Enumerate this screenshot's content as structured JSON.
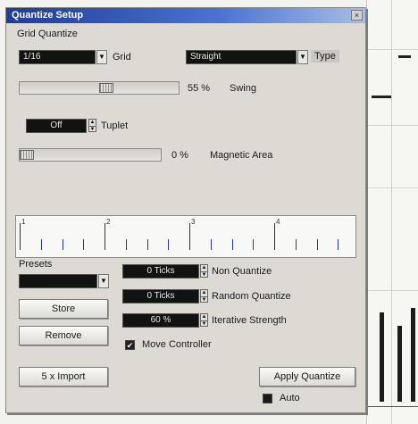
{
  "dialog": {
    "title": "Quantize Setup",
    "close_glyph": "×",
    "grid_quantize_label": "Grid Quantize",
    "grid": {
      "value": "1/16",
      "label": "Grid"
    },
    "type": {
      "value": "Straight",
      "label": "Type"
    },
    "swing": {
      "value_text": "55 %",
      "label": "Swing",
      "level": 0.55
    },
    "tuplet": {
      "value": "Off",
      "label": "Tuplet"
    },
    "magnetic_area": {
      "value_text": "0 %",
      "label": "Magnetic Area",
      "level": 0.0
    },
    "ruler": {
      "labels": [
        "1",
        "2",
        "3",
        "4"
      ]
    },
    "presets": {
      "label": "Presets",
      "value": "",
      "store_label": "Store",
      "remove_label": "Remove"
    },
    "non_quantize": {
      "value": "0 Ticks",
      "label": "Non Quantize"
    },
    "random_quantize": {
      "value": "0 Ticks",
      "label": "Random Quantize"
    },
    "iterative_strength": {
      "value": "60 %",
      "label": "Iterative Strength"
    },
    "move_controller": {
      "label": "Move Controller",
      "checked": true
    },
    "import_label": "5 x Import",
    "apply_label": "Apply Quantize",
    "auto": {
      "label": "Auto",
      "checked": false
    }
  },
  "colors": {
    "title_start": "#1f3c9a",
    "title_end": "#a8bde8",
    "ruler_tick": "#2238a0",
    "dark_field": "#121212"
  },
  "icons": {
    "close": "close-icon",
    "dropdown": "chevron-down-icon",
    "spin": "spin-arrows-icon",
    "check": "check-icon"
  }
}
